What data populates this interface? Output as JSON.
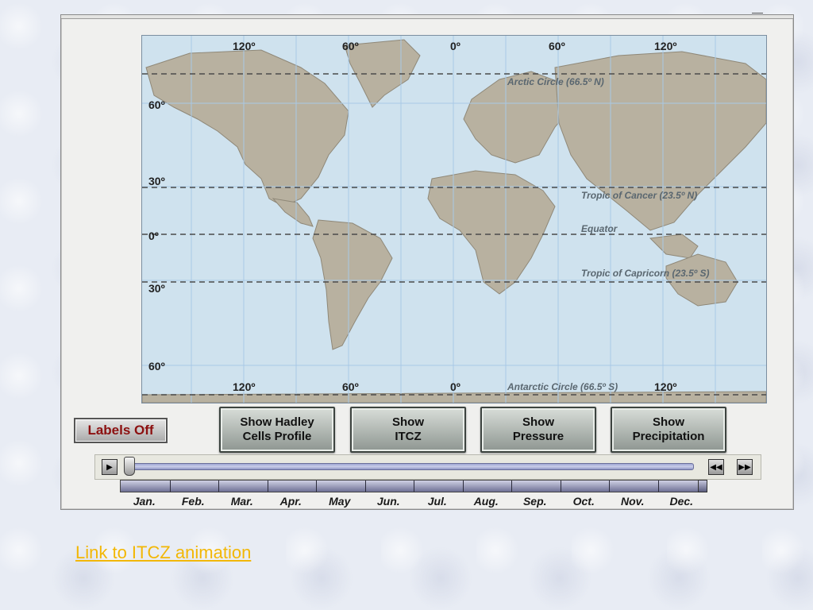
{
  "map": {
    "lon_labels_top": [
      "120º",
      "60º",
      "0º",
      "60º",
      "120º"
    ],
    "lon_labels_bottom": [
      "120º",
      "60º",
      "0º",
      "120º"
    ],
    "lat_labels": [
      "60º",
      "30º",
      "0º",
      "30º",
      "60º"
    ],
    "circles": {
      "arctic": "Arctic Circle (66.5º N)",
      "cancer": "Tropic of Cancer (23.5º N)",
      "equator": "Equator",
      "capricorn": "Tropic of Capricorn (23.5º S)",
      "antarctic": "Antarctic Circle (66.5º S)"
    },
    "colors": {
      "ocean": "#cfe2ee",
      "land": "#b8b1a0",
      "grid": "#a9c9e6",
      "dash": "#4a4a4a"
    }
  },
  "controls": {
    "labels_button": "Labels Off",
    "hadley_button": "Show Hadley\nCells Profile",
    "itcz_button": "Show\nITCZ",
    "pressure_button": "Show\nPressure",
    "precip_button": "Show\nPrecipitation",
    "play_icon": "play-icon",
    "rewind_icon": "rewind-icon",
    "forward_icon": "fast-forward-icon"
  },
  "months": [
    "Jan.",
    "Feb.",
    "Mar.",
    "Apr.",
    "May",
    "Jun.",
    "Jul.",
    "Aug.",
    "Sep.",
    "Oct.",
    "Nov.",
    "Dec."
  ],
  "timeline": {
    "position_fraction": 0.0
  },
  "link": {
    "text": "Link to ITCZ animation"
  }
}
